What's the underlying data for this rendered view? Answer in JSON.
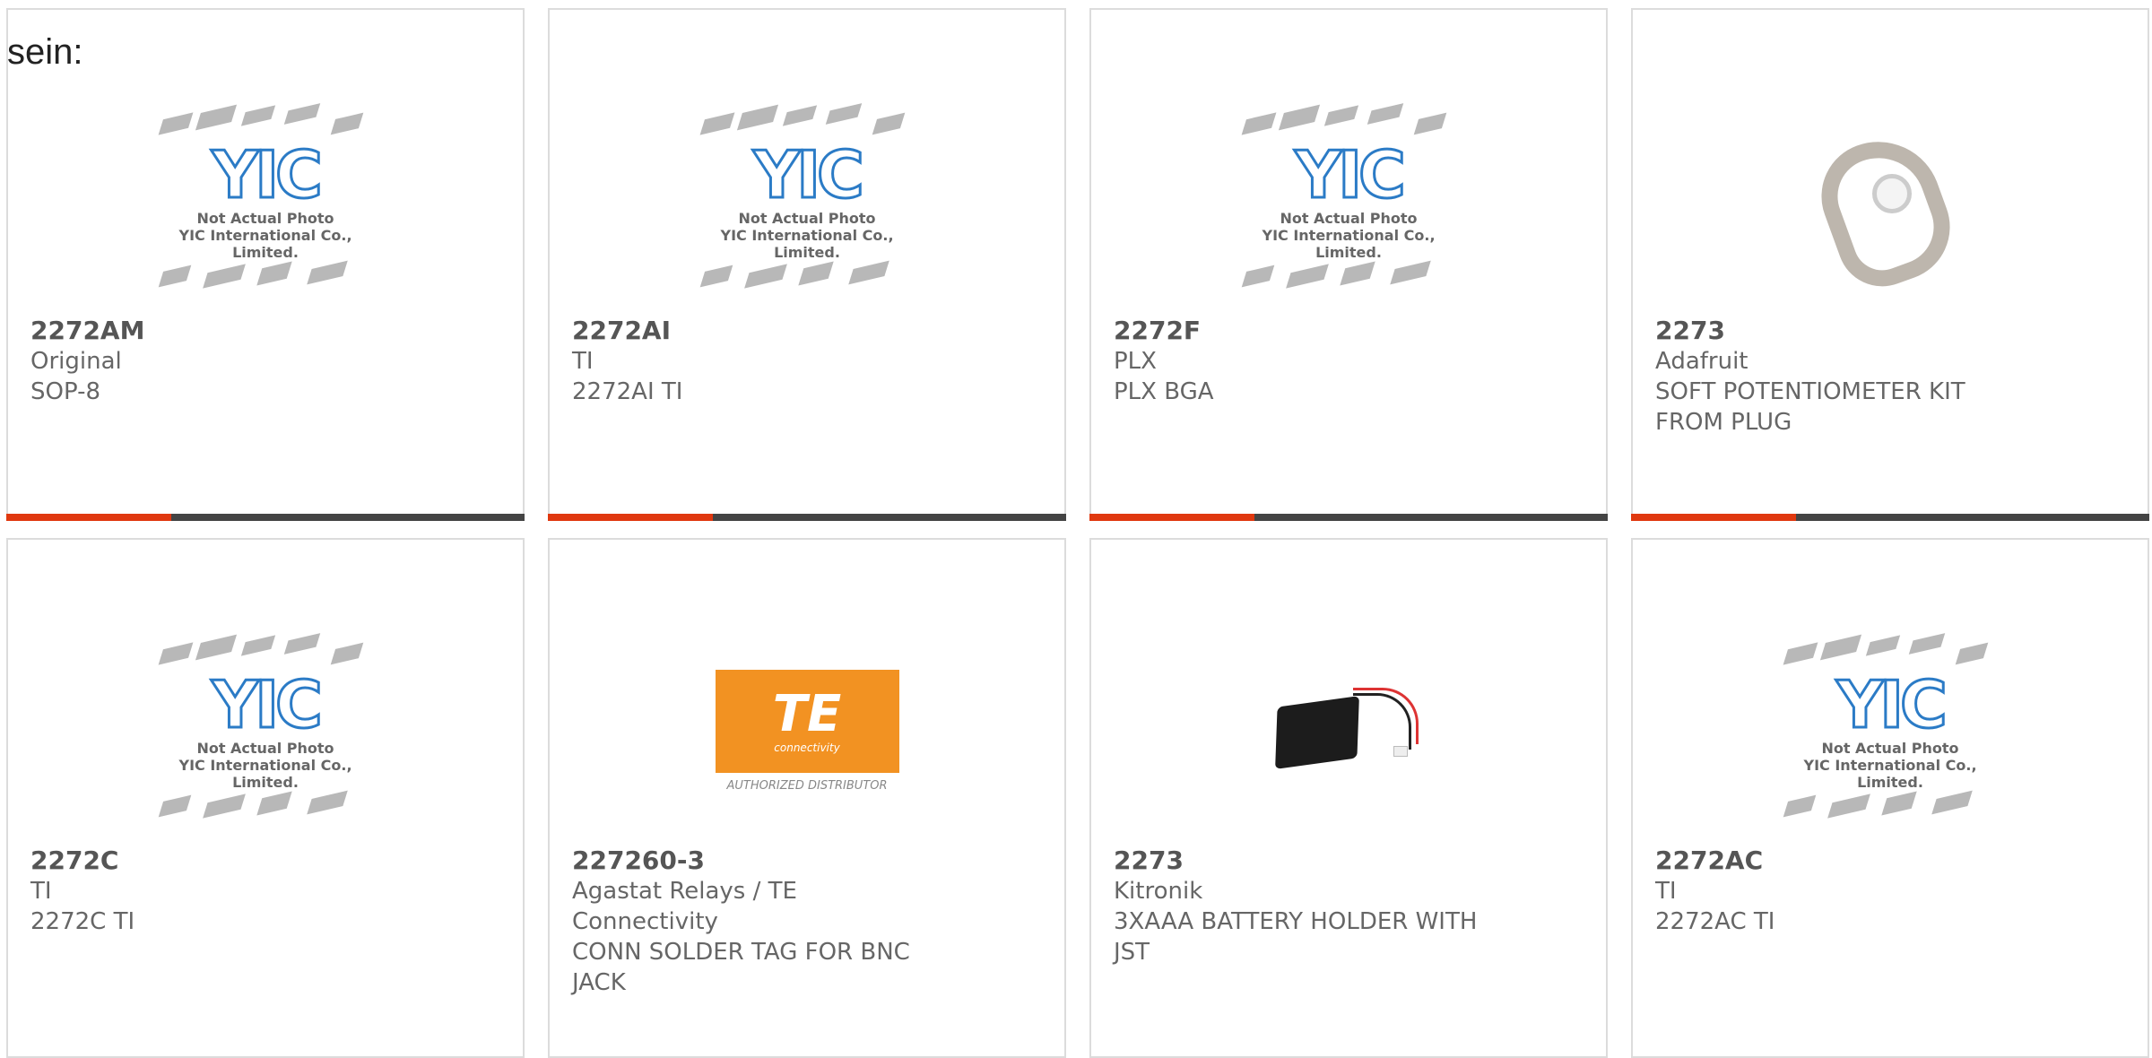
{
  "page": {
    "label": "sein:"
  },
  "placeholder": {
    "logo_text": "YIC",
    "caption_line1": "Not Actual Photo",
    "caption_line2": "YIC International Co., Limited."
  },
  "te_logo": {
    "text": "TE",
    "sub": "connectivity",
    "authorized": "AUTHORIZED DISTRIBUTOR"
  },
  "colors": {
    "accent": "#e0380f",
    "bar": "#444444",
    "border": "#dcdcdc",
    "te_orange": "#f29222",
    "yic_blue": "#2b7bc6"
  },
  "products": [
    {
      "part": "2272AM",
      "maker": "Original",
      "desc": "SOP-8",
      "image": "yic-placeholder"
    },
    {
      "part": "2272AI",
      "maker": "TI",
      "desc": "2272AI TI",
      "image": "yic-placeholder"
    },
    {
      "part": "2272F",
      "maker": "PLX",
      "desc": "PLX BGA",
      "image": "yic-placeholder"
    },
    {
      "part": "2273",
      "maker": "Adafruit",
      "desc": "SOFT POTENTIOMETER KIT FROM PLUG",
      "image": "potentiometer-kit"
    },
    {
      "part": "2272C",
      "maker": "TI",
      "desc": "2272C TI",
      "image": "yic-placeholder"
    },
    {
      "part": "227260-3",
      "maker": "Agastat Relays / TE Connectivity",
      "desc": "CONN SOLDER TAG FOR BNC JACK",
      "image": "te-logo"
    },
    {
      "part": "2273",
      "maker": "Kitronik",
      "desc": "3XAAA BATTERY HOLDER WITH JST",
      "image": "battery-holder"
    },
    {
      "part": "2272AC",
      "maker": "TI",
      "desc": "2272AC TI",
      "image": "yic-placeholder"
    }
  ]
}
